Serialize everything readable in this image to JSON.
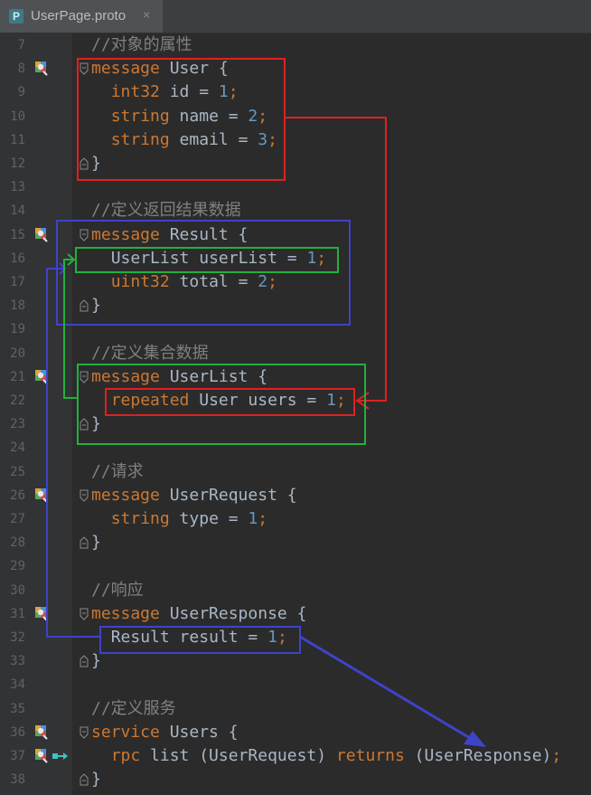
{
  "tab": {
    "icon_letter": "P",
    "title": "UserPage.proto",
    "close": "×"
  },
  "lines": [
    {
      "n": "7",
      "t": "comment",
      "text": "//对象的属性"
    },
    {
      "n": "8",
      "t": "decl",
      "kw": "message",
      "name": " User {",
      "icon": "proto-structure-icon",
      "fold": "open"
    },
    {
      "n": "9",
      "t": "field",
      "indent": "  ",
      "type": "int32",
      "rest": " id = ",
      "num": "1",
      "semi": ";"
    },
    {
      "n": "10",
      "t": "field",
      "indent": "  ",
      "type": "string",
      "rest": " name = ",
      "num": "2",
      "semi": ";"
    },
    {
      "n": "11",
      "t": "field",
      "indent": "  ",
      "type": "string",
      "rest": " email = ",
      "num": "3",
      "semi": ";"
    },
    {
      "n": "12",
      "t": "plain",
      "text": "}",
      "fold": "close"
    },
    {
      "n": "13",
      "t": "plain",
      "text": ""
    },
    {
      "n": "14",
      "t": "comment",
      "text": "//定义返回结果数据"
    },
    {
      "n": "15",
      "t": "decl",
      "kw": "message",
      "name": " Result {",
      "icon": "proto-structure-icon",
      "fold": "open"
    },
    {
      "n": "16",
      "t": "field",
      "indent": "  ",
      "type": "",
      "plainType": "UserList",
      "rest": " userList = ",
      "num": "1",
      "semi": ";"
    },
    {
      "n": "17",
      "t": "field",
      "indent": "  ",
      "type": "uint32",
      "rest": " total = ",
      "num": "2",
      "semi": ";"
    },
    {
      "n": "18",
      "t": "plain",
      "text": "}",
      "fold": "close"
    },
    {
      "n": "19",
      "t": "plain",
      "text": ""
    },
    {
      "n": "20",
      "t": "comment",
      "text": "//定义集合数据"
    },
    {
      "n": "21",
      "t": "decl",
      "kw": "message",
      "name": " UserList {",
      "icon": "proto-structure-icon",
      "fold": "open"
    },
    {
      "n": "22",
      "t": "field",
      "indent": "  ",
      "type": "repeated",
      "rest": " User users = ",
      "num": "1",
      "semi": ";"
    },
    {
      "n": "23",
      "t": "plain",
      "text": "}",
      "fold": "close"
    },
    {
      "n": "24",
      "t": "plain",
      "text": ""
    },
    {
      "n": "25",
      "t": "comment",
      "text": "//请求"
    },
    {
      "n": "26",
      "t": "decl",
      "kw": "message",
      "name": " UserRequest {",
      "icon": "proto-structure-icon",
      "fold": "open"
    },
    {
      "n": "27",
      "t": "field",
      "indent": "  ",
      "type": "string",
      "rest": " type = ",
      "num": "1",
      "semi": ";"
    },
    {
      "n": "28",
      "t": "plain",
      "text": "}",
      "fold": "close"
    },
    {
      "n": "29",
      "t": "plain",
      "text": ""
    },
    {
      "n": "30",
      "t": "comment",
      "text": "//响应"
    },
    {
      "n": "31",
      "t": "decl",
      "kw": "message",
      "name": " UserResponse {",
      "icon": "proto-structure-icon",
      "fold": "open"
    },
    {
      "n": "32",
      "t": "field",
      "indent": "  ",
      "type": "",
      "plainType": "Result",
      "rest": " result = ",
      "num": "1",
      "semi": ";"
    },
    {
      "n": "33",
      "t": "plain",
      "text": "}",
      "fold": "close"
    },
    {
      "n": "34",
      "t": "plain",
      "text": ""
    },
    {
      "n": "35",
      "t": "comment",
      "text": "//定义服务"
    },
    {
      "n": "36",
      "t": "decl",
      "kw": "service",
      "name": " Users {",
      "icon": "proto-structure-icon",
      "fold": "open"
    },
    {
      "n": "37",
      "t": "rpc",
      "indent": "  ",
      "kw1": "rpc",
      "mid": " list (UserRequest) ",
      "kw2": "returns",
      "tail": " (UserResponse)",
      "semi": ";",
      "icon": "proto-structure-icon",
      "runIcon": "rpc-method-icon"
    },
    {
      "n": "38",
      "t": "plain",
      "text": "}",
      "fold": "close"
    }
  ],
  "colors": {
    "red": "#e02020",
    "blue": "#3e43c8",
    "green": "#22b03c",
    "keyword": "#cc7832",
    "number": "#6897bb",
    "comment": "#808080",
    "text": "#a9b7c6"
  }
}
